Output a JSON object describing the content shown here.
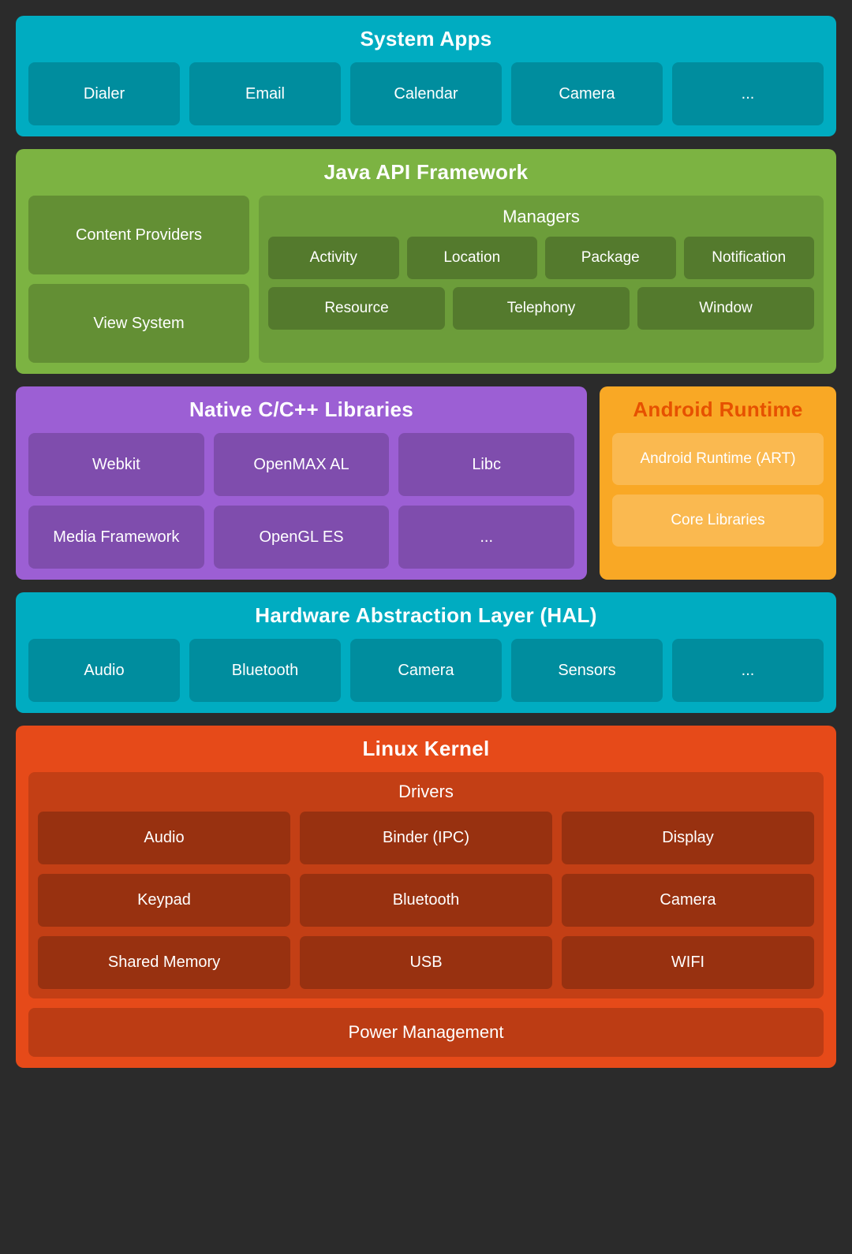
{
  "systemApps": {
    "title": "System Apps",
    "items": [
      "Dialer",
      "Email",
      "Calendar",
      "Camera",
      "..."
    ]
  },
  "javaApi": {
    "title": "Java API Framework",
    "left": {
      "items": [
        "Content Providers",
        "View System"
      ]
    },
    "right": {
      "managersTitle": "Managers",
      "row1": [
        "Activity",
        "Location",
        "Package",
        "Notification"
      ],
      "row2": [
        "Resource",
        "Telephony",
        "Window"
      ]
    }
  },
  "nativeCpp": {
    "title": "Native C/C++ Libraries",
    "items": [
      "Webkit",
      "OpenMAX AL",
      "Libc",
      "Media Framework",
      "OpenGL ES",
      "..."
    ]
  },
  "androidRuntime": {
    "title": "Android Runtime",
    "items": [
      "Android Runtime (ART)",
      "Core Libraries"
    ]
  },
  "hal": {
    "title": "Hardware Abstraction Layer (HAL)",
    "items": [
      "Audio",
      "Bluetooth",
      "Camera",
      "Sensors",
      "..."
    ]
  },
  "linuxKernel": {
    "title": "Linux Kernel",
    "driversTitle": "Drivers",
    "drivers": [
      "Audio",
      "Binder (IPC)",
      "Display",
      "Keypad",
      "Bluetooth",
      "Camera",
      "Shared Memory",
      "USB",
      "WIFI"
    ],
    "powerManagement": "Power Management"
  }
}
